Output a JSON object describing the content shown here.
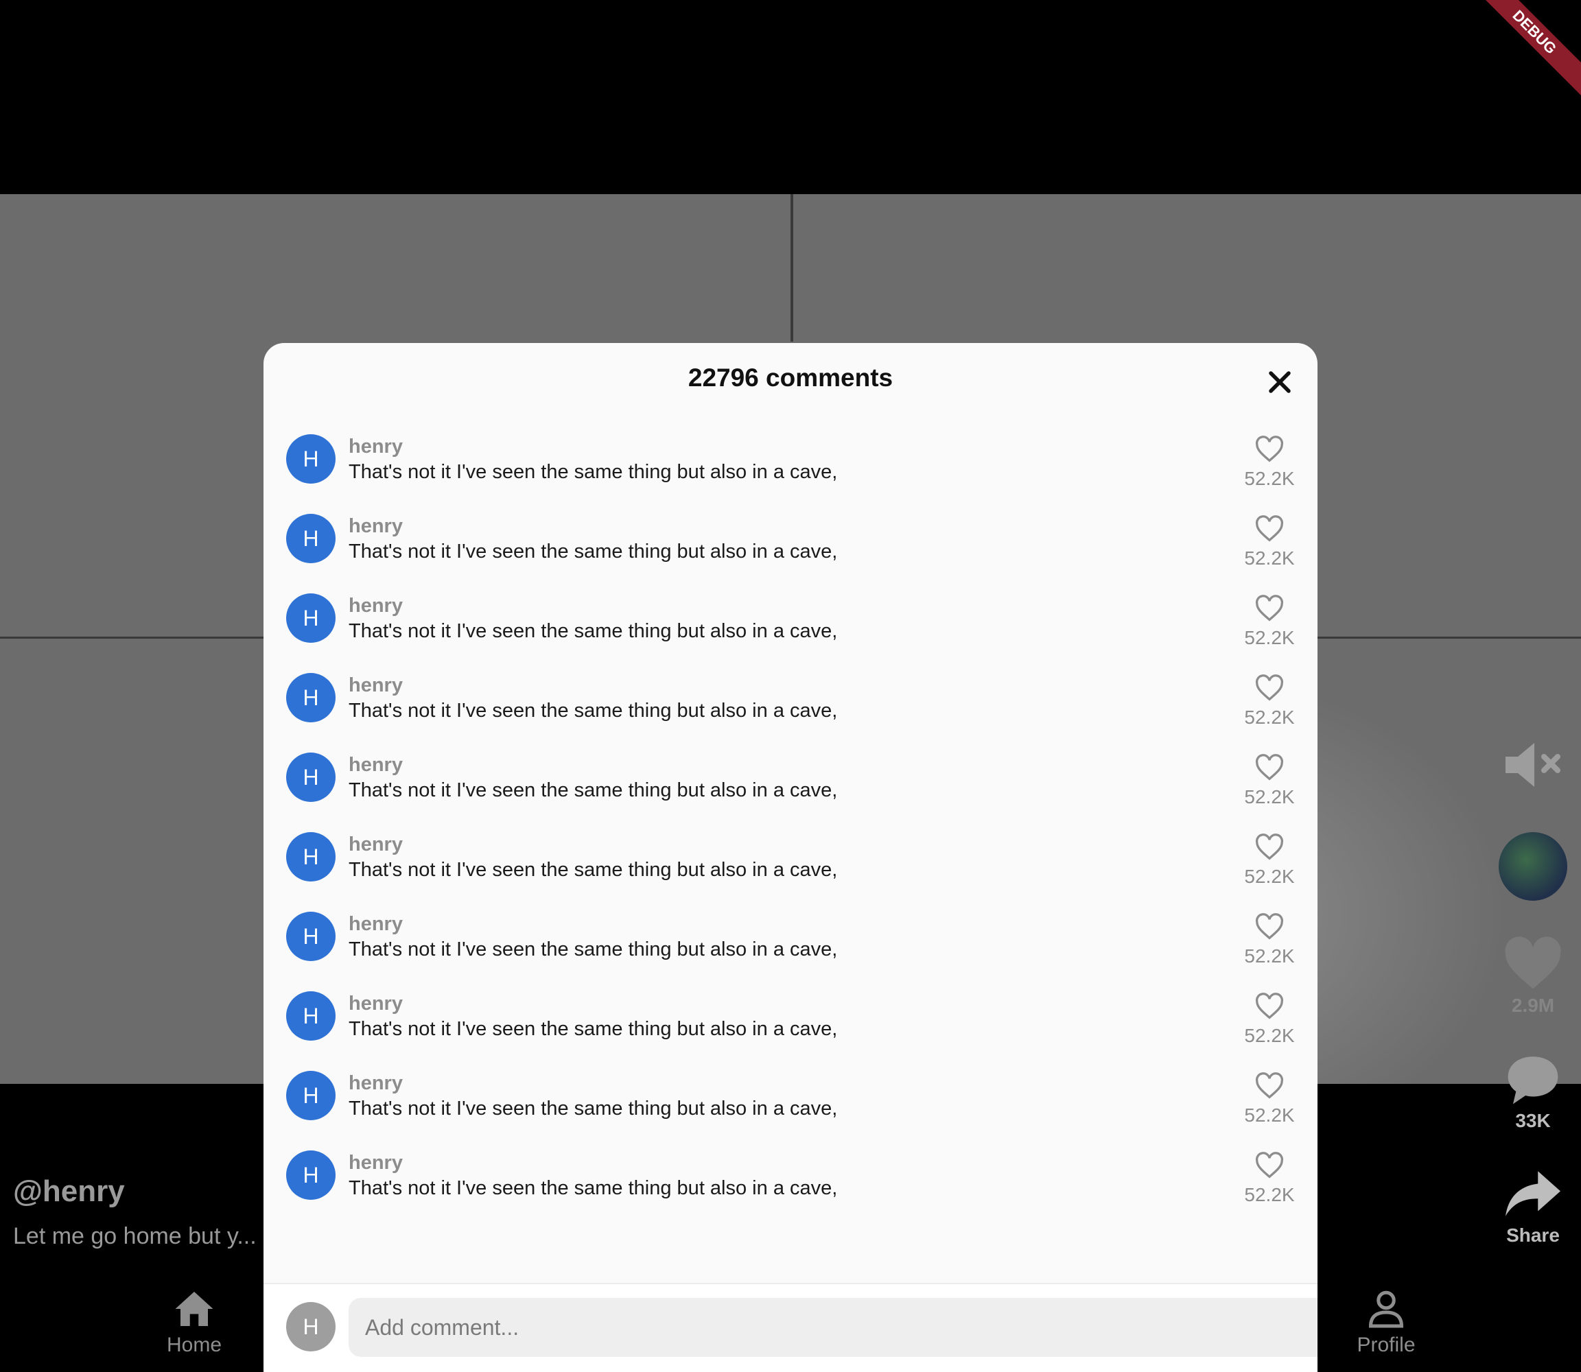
{
  "debug_banner": "DEBUG",
  "video": {
    "handle": "@henry",
    "caption": "Let me go home but y..."
  },
  "side_actions": {
    "likes": "2.9M",
    "comments": "33K",
    "share": "Share"
  },
  "bottom_nav": {
    "home": "Home",
    "profile": "Profile"
  },
  "modal": {
    "title": "22796 comments",
    "comments": [
      {
        "avatar": "H",
        "user": "henry",
        "text": "That's not it I've seen the same thing but also in a cave,",
        "likes": "52.2K"
      },
      {
        "avatar": "H",
        "user": "henry",
        "text": "That's not it I've seen the same thing but also in a cave,",
        "likes": "52.2K"
      },
      {
        "avatar": "H",
        "user": "henry",
        "text": "That's not it I've seen the same thing but also in a cave,",
        "likes": "52.2K"
      },
      {
        "avatar": "H",
        "user": "henry",
        "text": "That's not it I've seen the same thing but also in a cave,",
        "likes": "52.2K"
      },
      {
        "avatar": "H",
        "user": "henry",
        "text": "That's not it I've seen the same thing but also in a cave,",
        "likes": "52.2K"
      },
      {
        "avatar": "H",
        "user": "henry",
        "text": "That's not it I've seen the same thing but also in a cave,",
        "likes": "52.2K"
      },
      {
        "avatar": "H",
        "user": "henry",
        "text": "That's not it I've seen the same thing but also in a cave,",
        "likes": "52.2K"
      },
      {
        "avatar": "H",
        "user": "henry",
        "text": "That's not it I've seen the same thing but also in a cave,",
        "likes": "52.2K"
      },
      {
        "avatar": "H",
        "user": "henry",
        "text": "That's not it I've seen the same thing but also in a cave,",
        "likes": "52.2K"
      },
      {
        "avatar": "H",
        "user": "henry",
        "text": "That's not it I've seen the same thing but also in a cave,",
        "likes": "52.2K"
      }
    ],
    "input": {
      "avatar": "H",
      "placeholder": "Add comment..."
    }
  }
}
